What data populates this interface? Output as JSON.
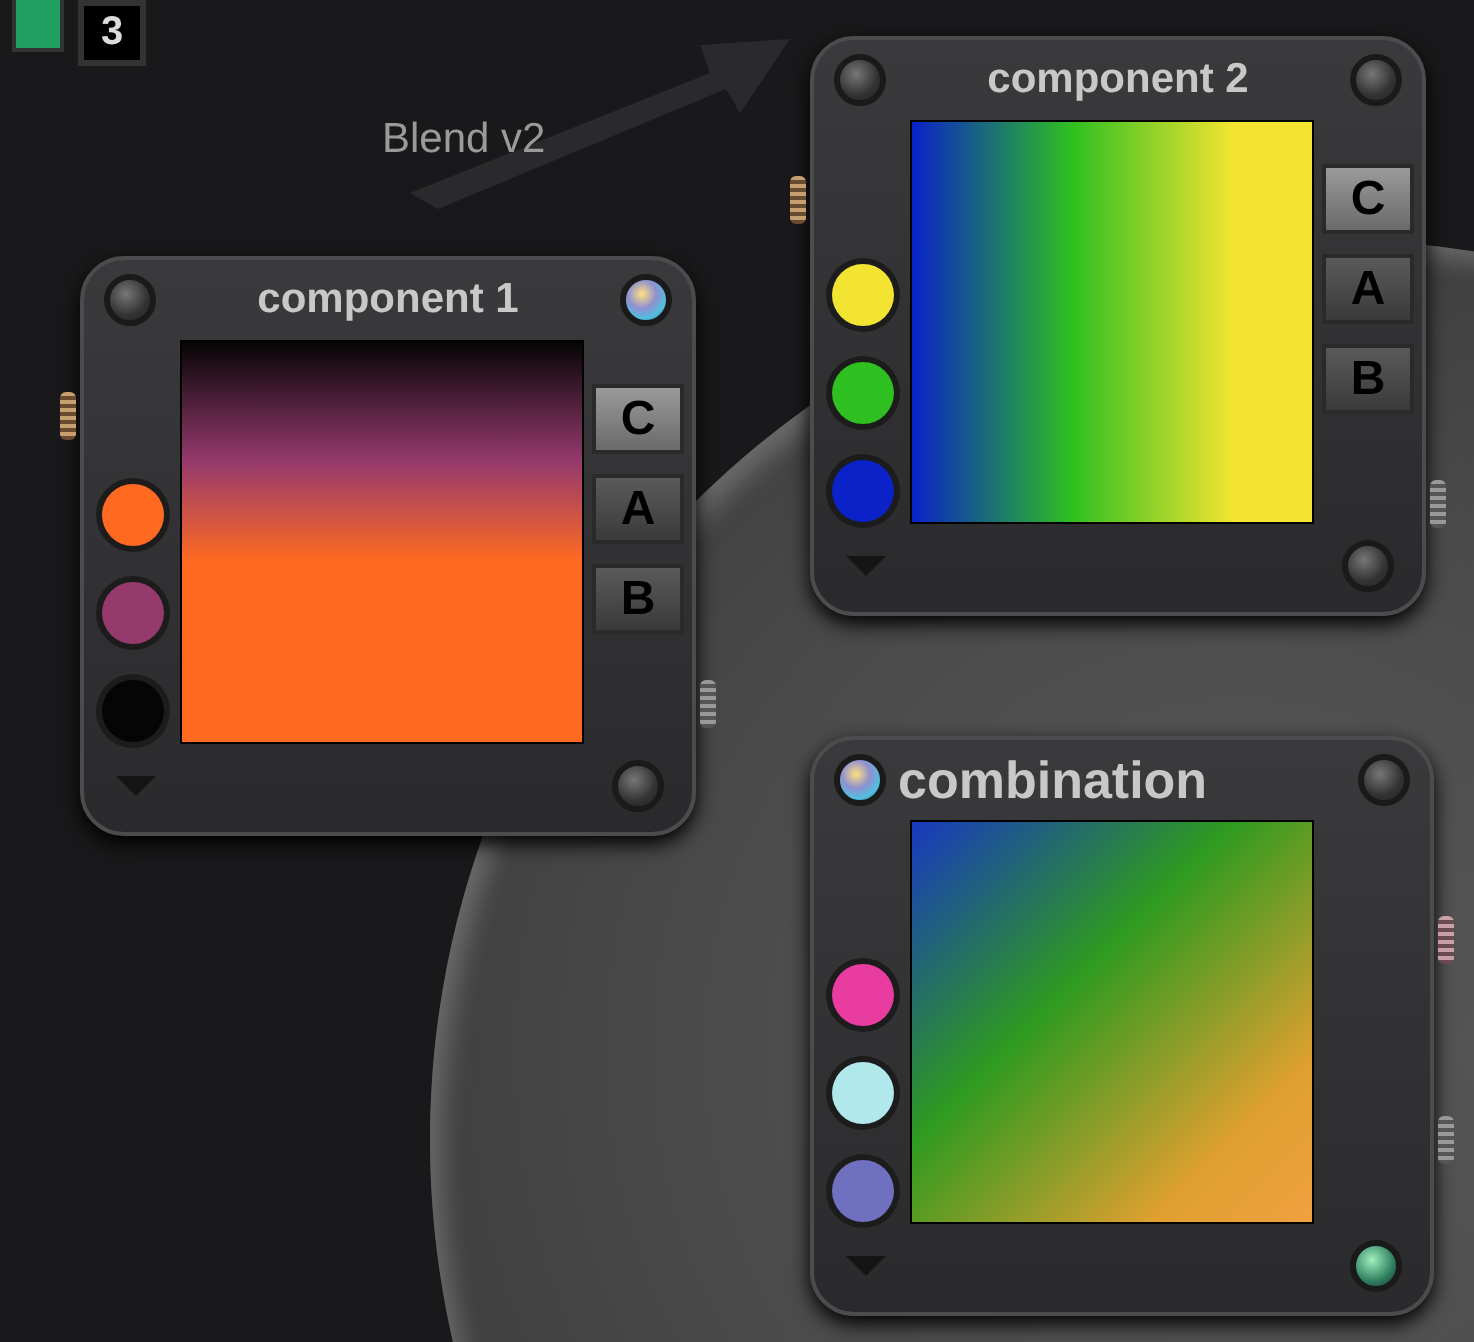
{
  "page_tab": {
    "label": "3"
  },
  "canvas_label": "Blend v2",
  "nodes": [
    {
      "title": "component 1",
      "knobs": [
        {
          "kind": "plain"
        },
        {
          "kind": "rainbow"
        },
        {
          "kind": "plain"
        }
      ],
      "swatches": [
        {
          "color": "#ff6a20"
        },
        {
          "color": "#963a6e"
        },
        {
          "color": "#050505"
        }
      ],
      "slots": [
        {
          "label": "C",
          "selected": true
        },
        {
          "label": "A",
          "selected": false
        },
        {
          "label": "B",
          "selected": false
        }
      ]
    },
    {
      "title": "component 2",
      "knobs": [
        {
          "kind": "plain"
        },
        {
          "kind": "plain"
        },
        {
          "kind": "plain"
        }
      ],
      "swatches": [
        {
          "color": "#f2e430"
        },
        {
          "color": "#2ec020"
        },
        {
          "color": "#0a22c8"
        }
      ],
      "slots": [
        {
          "label": "C",
          "selected": true
        },
        {
          "label": "A",
          "selected": false
        },
        {
          "label": "B",
          "selected": false
        }
      ]
    },
    {
      "title": "combination",
      "knobs": [
        {
          "kind": "rainbow"
        },
        {
          "kind": "plain"
        },
        {
          "kind": "green"
        }
      ],
      "swatches": [
        {
          "color": "#e83ca0"
        },
        {
          "color": "#b0e8ec"
        },
        {
          "color": "#7070c0"
        }
      ]
    }
  ]
}
